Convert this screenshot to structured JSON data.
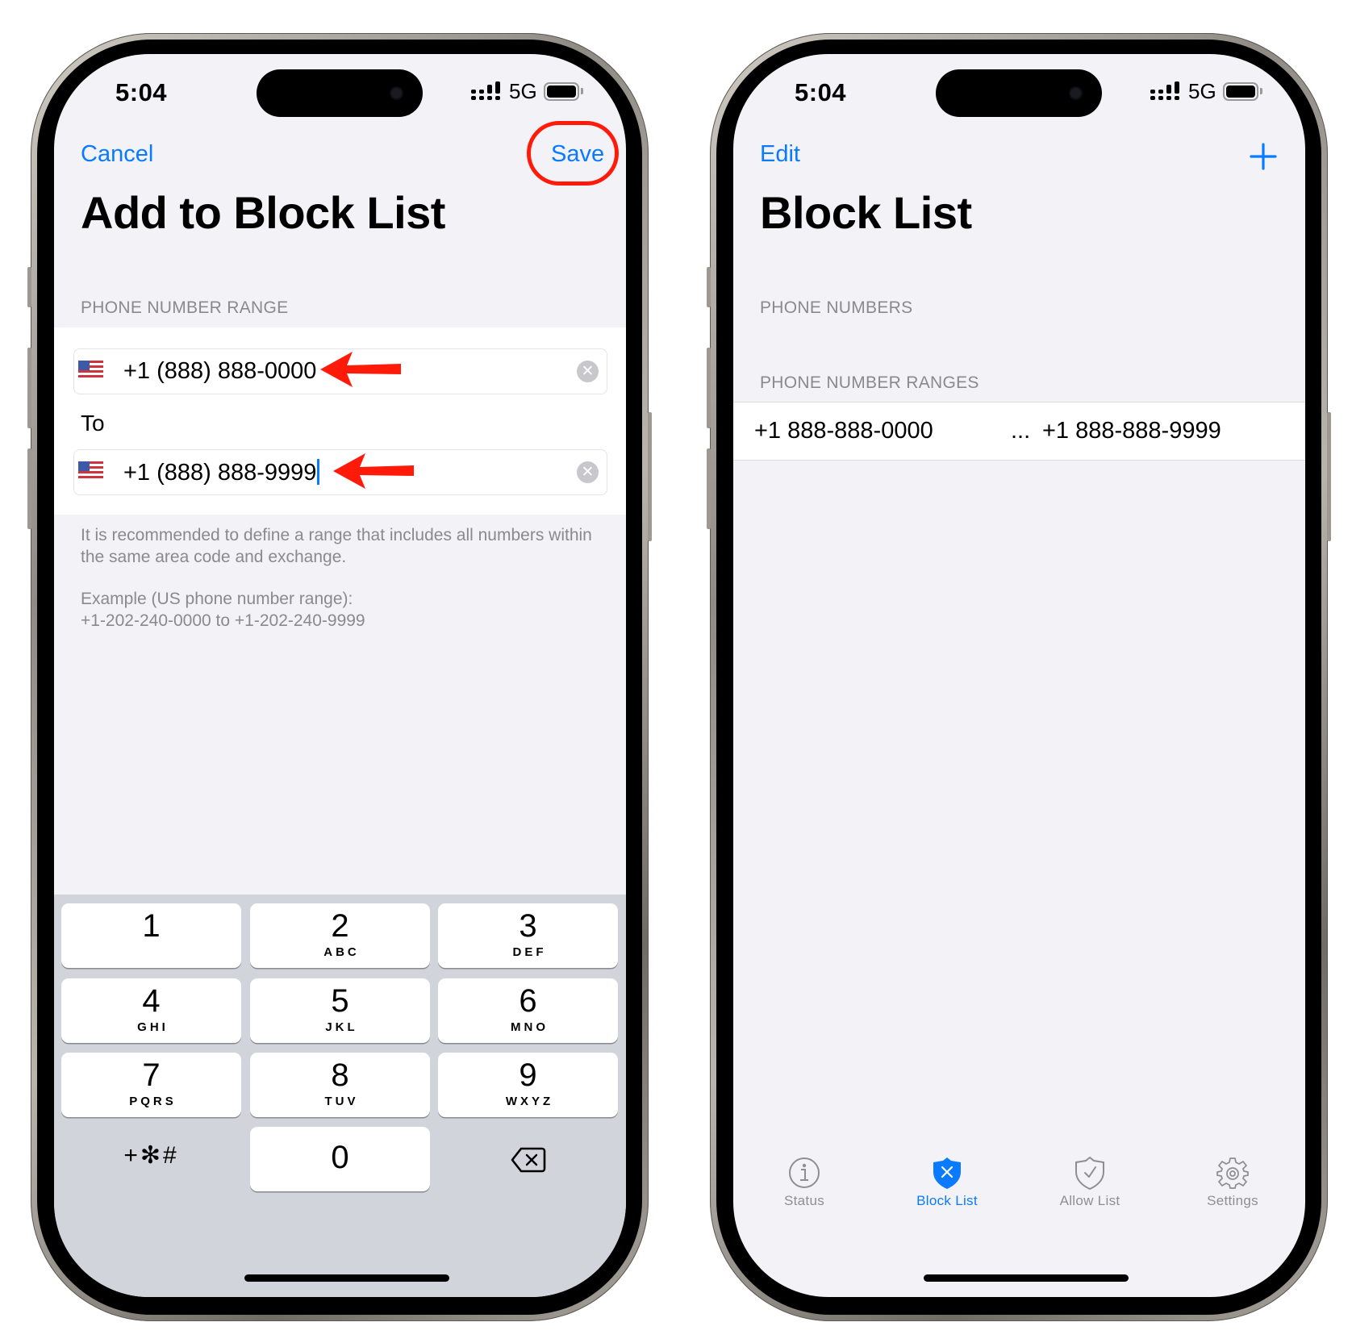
{
  "colors": {
    "accent": "#0a7aff",
    "annotation_red": "#ff1a0a",
    "secondary_text": "#8a8a8e",
    "background": "#f2f2f7",
    "keyboard_bg": "#d1d4db"
  },
  "left_screen": {
    "status_bar": {
      "time": "5:04",
      "network": "5G"
    },
    "nav": {
      "cancel_label": "Cancel",
      "save_label": "Save"
    },
    "title": "Add to Block List",
    "section_header": "PHONE NUMBER RANGE",
    "from_field": {
      "flag_icon": "us-flag-icon",
      "value": "+1 (888) 888-0000",
      "clear_icon": "clear-icon"
    },
    "to_label": "To",
    "to_field": {
      "flag_icon": "us-flag-icon",
      "value": "+1 (888) 888-9999",
      "clear_icon": "clear-icon",
      "focused": true
    },
    "footer": {
      "recommendation": "It is recommended to define a range that includes all numbers within the same area code and exchange.",
      "example_title": "Example (US phone number range):",
      "example_value": "+1-202-240-0000 to +1-202-240-9999"
    },
    "annotations": {
      "save_highlight": "red-circle",
      "field_arrows": "red-arrow-left"
    },
    "keypad": {
      "keys": [
        {
          "digit": "1",
          "letters": ""
        },
        {
          "digit": "2",
          "letters": "ABC"
        },
        {
          "digit": "3",
          "letters": "DEF"
        },
        {
          "digit": "4",
          "letters": "GHI"
        },
        {
          "digit": "5",
          "letters": "JKL"
        },
        {
          "digit": "6",
          "letters": "MNO"
        },
        {
          "digit": "7",
          "letters": "PQRS"
        },
        {
          "digit": "8",
          "letters": "TUV"
        },
        {
          "digit": "9",
          "letters": "WXYZ"
        },
        {
          "digit": "0",
          "letters": ""
        }
      ],
      "symbols_label": "+✻#",
      "delete_icon": "backspace-icon"
    }
  },
  "right_screen": {
    "status_bar": {
      "time": "5:04",
      "network": "5G"
    },
    "nav": {
      "edit_label": "Edit",
      "add_icon": "plus-icon"
    },
    "title": "Block List",
    "phone_numbers_header": "PHONE NUMBERS",
    "ranges_header": "PHONE NUMBER RANGES",
    "ranges": [
      {
        "from": "+1 888-888-0000",
        "separator": "...",
        "to": "+1 888-888-9999"
      }
    ],
    "tabs": [
      {
        "label": "Status",
        "icon": "info-icon",
        "active": false
      },
      {
        "label": "Block List",
        "icon": "shield-x-icon",
        "active": true
      },
      {
        "label": "Allow List",
        "icon": "shield-check-icon",
        "active": false
      },
      {
        "label": "Settings",
        "icon": "gear-icon",
        "active": false
      }
    ]
  }
}
